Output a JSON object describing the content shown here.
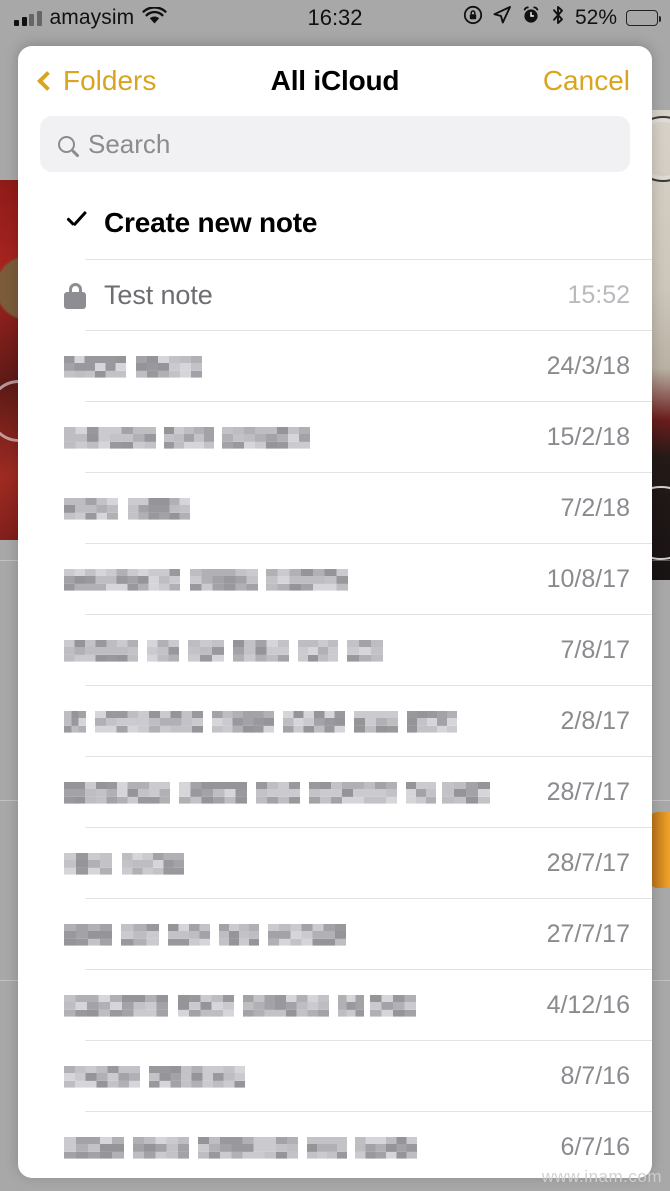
{
  "status_bar": {
    "carrier": "amaysim",
    "signal_bars_filled": 2,
    "signal_bars_total": 4,
    "wifi_icon": "wifi-icon",
    "time": "16:32",
    "icons": [
      "rotation-lock-icon",
      "location-arrow-icon",
      "alarm-clock-icon",
      "bluetooth-icon"
    ],
    "battery_percent": "52%",
    "battery_level": 52
  },
  "nav": {
    "back_label": "Folders",
    "title": "All iCloud",
    "cancel_label": "Cancel"
  },
  "search": {
    "placeholder": "Search",
    "value": "",
    "icon": "search-icon"
  },
  "list": {
    "create_row": {
      "label": "Create new note",
      "icon": "checkmark-icon",
      "selected": true
    },
    "rows": [
      {
        "title": "Test note",
        "redacted": false,
        "locked": true,
        "date": "15:52",
        "is_time": true,
        "blur_widths": []
      },
      {
        "title": "",
        "redacted": true,
        "locked": false,
        "date": "24/3/18",
        "is_time": false,
        "blur_widths": [
          62,
          10,
          66
        ]
      },
      {
        "title": "",
        "redacted": true,
        "locked": false,
        "date": "15/2/18",
        "is_time": false,
        "blur_widths": [
          92,
          8,
          50,
          8,
          88
        ]
      },
      {
        "title": "",
        "redacted": true,
        "locked": false,
        "date": "7/2/18",
        "is_time": false,
        "blur_widths": [
          54,
          10,
          62
        ]
      },
      {
        "title": "",
        "redacted": true,
        "locked": false,
        "date": "10/8/17",
        "is_time": false,
        "blur_widths": [
          116,
          10,
          68,
          8,
          82
        ]
      },
      {
        "title": "",
        "redacted": true,
        "locked": false,
        "date": "7/8/17",
        "is_time": false,
        "blur_widths": [
          74,
          9,
          32,
          9,
          36,
          9,
          56,
          9,
          40,
          9,
          36
        ]
      },
      {
        "title": "",
        "redacted": true,
        "locked": false,
        "date": "2/8/17",
        "is_time": false,
        "blur_widths": [
          22,
          9,
          108,
          9,
          62,
          9,
          62,
          9,
          44,
          9,
          50
        ]
      },
      {
        "title": "",
        "redacted": true,
        "locked": false,
        "date": "28/7/17",
        "is_time": false,
        "blur_widths": [
          106,
          9,
          68,
          9,
          44,
          9,
          88,
          9,
          30,
          6,
          48
        ]
      },
      {
        "title": "",
        "redacted": true,
        "locked": false,
        "date": "28/7/17",
        "is_time": false,
        "blur_widths": [
          48,
          10,
          62
        ]
      },
      {
        "title": "",
        "redacted": true,
        "locked": false,
        "date": "27/7/17",
        "is_time": false,
        "blur_widths": [
          48,
          9,
          38,
          9,
          42,
          9,
          40,
          9,
          78
        ]
      },
      {
        "title": "",
        "redacted": true,
        "locked": false,
        "date": "4/12/16",
        "is_time": false,
        "blur_widths": [
          104,
          10,
          56,
          9,
          86,
          9,
          26,
          6,
          46
        ]
      },
      {
        "title": "",
        "redacted": true,
        "locked": false,
        "date": "8/7/16",
        "is_time": false,
        "blur_widths": [
          76,
          9,
          96
        ]
      },
      {
        "title": "",
        "redacted": true,
        "locked": false,
        "date": "6/7/16",
        "is_time": false,
        "blur_widths": [
          60,
          9,
          56,
          9,
          100,
          9,
          40,
          8,
          62
        ]
      }
    ]
  },
  "watermark": "www.inam.com",
  "colors": {
    "accent": "#d9a520",
    "title": "#000000",
    "secondary_text": "#6d6d72",
    "date_text": "#8a8a8f",
    "separator": "#e3e3e6",
    "search_bg": "#f1f1f3",
    "sheet_bg": "#ffffff",
    "backdrop": "#a8a8a8"
  }
}
